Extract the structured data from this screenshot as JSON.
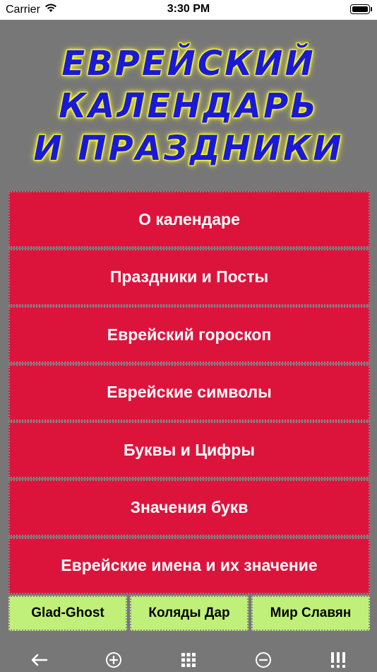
{
  "status_bar": {
    "carrier": "Carrier",
    "time": "3:30 PM"
  },
  "title": {
    "lines": [
      "ЕВРЕЙСКИЙ",
      "КАЛЕНДАРЬ",
      "И ПРАЗДНИКИ"
    ]
  },
  "menu": {
    "items": [
      "О календаре",
      "Праздники и Посты",
      "Еврейский гороскоп",
      "Еврейские символы",
      "Буквы и Цифры",
      "Значения букв",
      "Еврейские имена и их значение"
    ]
  },
  "links": {
    "items": [
      "Glad-Ghost",
      "Коляды Дар",
      "Мир Славян"
    ]
  },
  "toolbar": {
    "icons": [
      "back-arrow-icon",
      "zoom-in-icon",
      "grid-icon",
      "zoom-out-icon",
      "menu-bars-icon"
    ]
  },
  "colors": {
    "background": "#777777",
    "menu_item": "#dc143c",
    "link_item": "#c0f07a",
    "title_text": "#1a1ad6",
    "title_glow": "#ffff33"
  }
}
